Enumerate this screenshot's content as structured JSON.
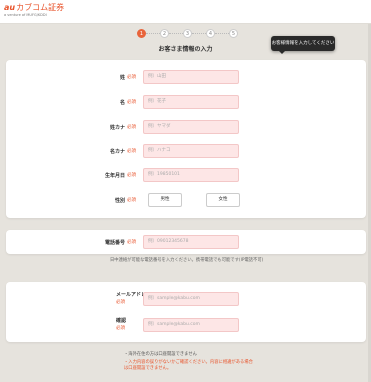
{
  "header": {
    "logo_au": "au",
    "logo_rest": "カブコム証券",
    "logo_sub": "a venture of MUFG/KDDI"
  },
  "steps": [
    "1",
    "2",
    "3",
    "4",
    "5"
  ],
  "page_title": "お客さま情報の入力",
  "toast": "お客様情報を入力してください",
  "form": {
    "required_tag": "必須",
    "last_name": {
      "label": "姓",
      "placeholder": "例）山田"
    },
    "first_name": {
      "label": "名",
      "placeholder": "例）花子"
    },
    "last_name_kana": {
      "label": "姓カナ",
      "placeholder": "例）ヤマダ"
    },
    "first_name_kana": {
      "label": "名カナ",
      "placeholder": "例）ハナコ"
    },
    "birthdate": {
      "label": "生年月日",
      "placeholder": "例）19850101"
    },
    "gender": {
      "label": "性別",
      "options": [
        "男性",
        "女性"
      ]
    },
    "phone": {
      "label": "電話番号",
      "placeholder": "例）09012345678"
    },
    "phone_note": "日中連絡が可能な電話番号を入力ください。携帯電話でも可能です(IP電話不可)",
    "email": {
      "label": "メールアドレス",
      "placeholder": "例）sample@kabu.com"
    },
    "email_confirm": {
      "label": "確認",
      "placeholder": "例）sample@kabu.com"
    }
  },
  "bottom_notes": {
    "line1": "・海外在住の方は口座開設できません",
    "line2": "・入力内容の誤りがないかご確認ください。内容に相違がある場合は口座開設できません。"
  }
}
